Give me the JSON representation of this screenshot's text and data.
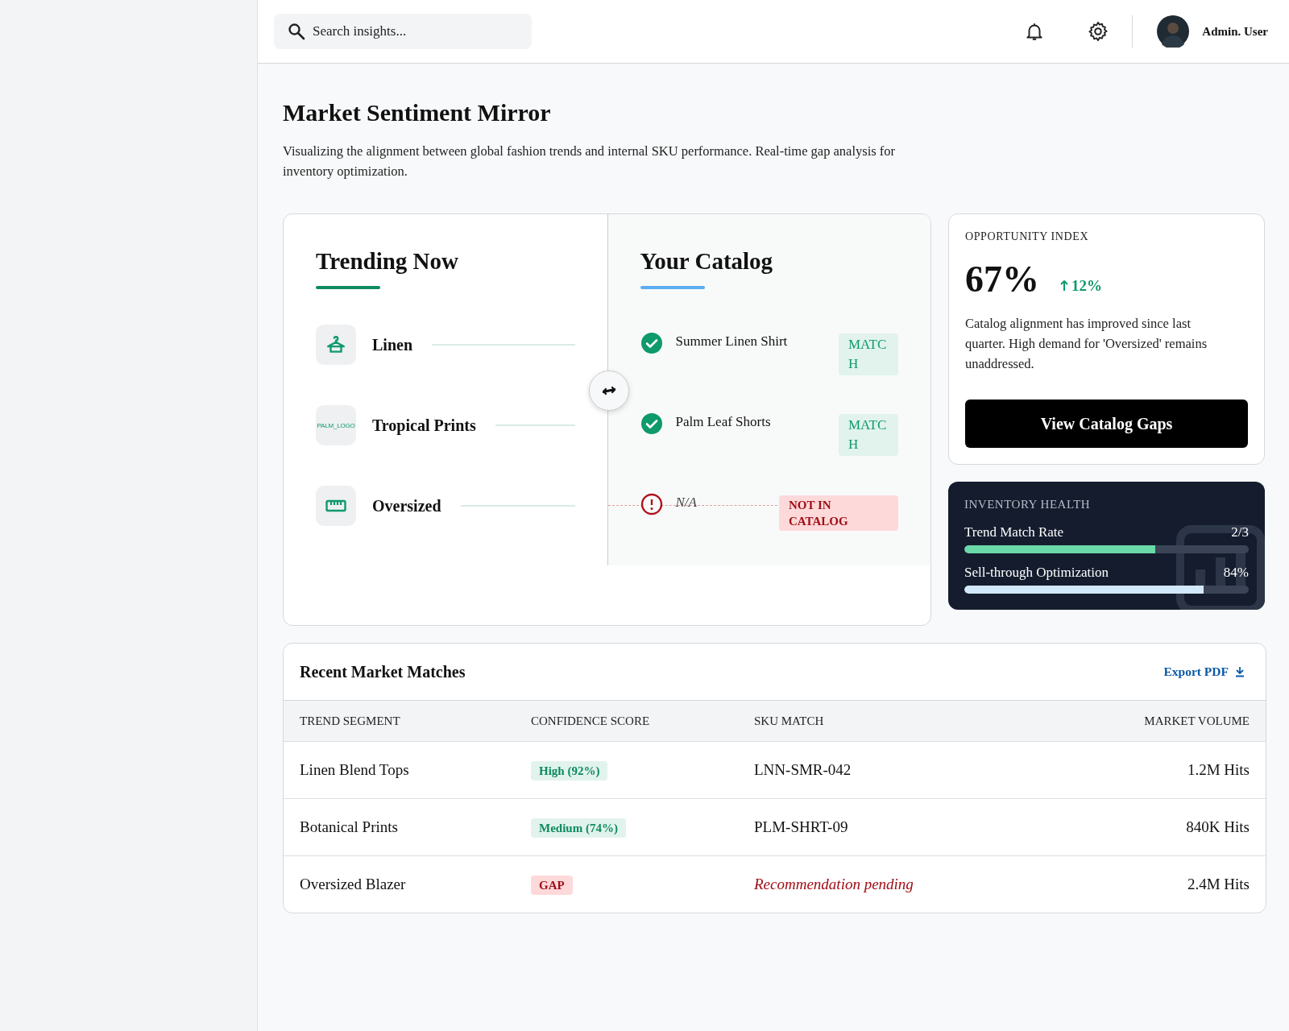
{
  "header": {
    "search": {
      "placeholder": "Search insights..."
    },
    "user": {
      "name": "Admin. User"
    }
  },
  "page": {
    "title": "Market Sentiment Mirror",
    "description": "Visualizing the alignment between global fashion trends and internal SKU performance. Real-time gap analysis for inventory optimization."
  },
  "mirror": {
    "trending": {
      "title": "Trending Now",
      "items": [
        {
          "label": "Linen",
          "kind": "hanger"
        },
        {
          "label": "Tropical Prints",
          "kind": "logo",
          "logo_text": "PALM_LOGO"
        },
        {
          "label": "Oversized",
          "kind": "ruler"
        }
      ]
    },
    "catalog": {
      "title": "Your Catalog",
      "items": [
        {
          "name": "Summer Linen Shirt",
          "kind": "match",
          "badge": "MATCH"
        },
        {
          "name": "Palm Leaf Shorts",
          "kind": "match",
          "badge": "MATCH"
        },
        {
          "name": "N/A",
          "kind": "gap",
          "badge": "NOT IN CATALOG"
        }
      ]
    }
  },
  "opportunity": {
    "label": "OPPORTUNITY INDEX",
    "value": "67%",
    "change": "12%",
    "text": "Catalog alignment has improved since last quarter. High demand for 'Oversized' remains unaddressed.",
    "button": "View Catalog Gaps"
  },
  "inventory_health": {
    "title": "INVENTORY HEALTH",
    "metrics": [
      {
        "label": "Trend Match Rate",
        "value": "2/3",
        "level": 0.67,
        "color": "#6ad9a8"
      },
      {
        "label": "Sell-through Optimization",
        "value": "84%",
        "level": 0.84,
        "color": "#d4e8fb"
      }
    ]
  },
  "matches": {
    "title": "Recent Market Matches",
    "export": "Export PDF",
    "columns": [
      "TREND SEGMENT",
      "CONFIDENCE SCORE",
      "SKU MATCH",
      "MARKET VOLUME"
    ],
    "rows": [
      {
        "segment": "Linen Blend Tops",
        "confidence": {
          "text": "High (92%)",
          "kind": "high"
        },
        "sku": {
          "text": "LNN-SMR-042",
          "kind": "code"
        },
        "volume": "1.2M Hits"
      },
      {
        "segment": "Botanical Prints",
        "confidence": {
          "text": "Medium (74%)",
          "kind": "medium"
        },
        "sku": {
          "text": "PLM-SHRT-09",
          "kind": "code"
        },
        "volume": "840K Hits"
      },
      {
        "segment": "Oversized Blazer",
        "confidence": {
          "text": "GAP",
          "kind": "gap"
        },
        "sku": {
          "text": "Recommendation pending",
          "kind": "pending"
        },
        "volume": "2.4M Hits"
      }
    ]
  }
}
